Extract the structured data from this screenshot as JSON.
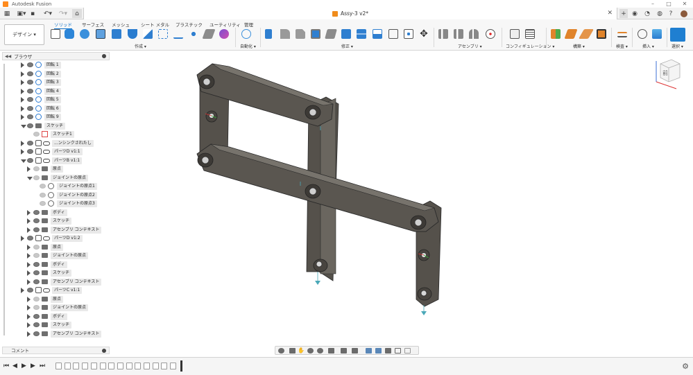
{
  "window": {
    "title": "Autodesk Fusion"
  },
  "document": {
    "name": "Assy-3 v2*"
  },
  "toolbar": {
    "workspace": "デザイン",
    "tabs": [
      "ソリッド",
      "サーフェス",
      "メッシュ",
      "シート メタル",
      "プラスチック",
      "ユーティリティ",
      "管理"
    ],
    "active_tab": "ソリッド",
    "groups": {
      "create": "作成",
      "automate": "自動化",
      "modify": "修正",
      "assemble": "アセンブリ",
      "configure": "コンフィギュレーション",
      "construct": "構築",
      "inspect": "検査",
      "insert": "挿入",
      "select": "選択"
    }
  },
  "browser": {
    "title": "ブラウザ",
    "rows": [
      {
        "label": "回転 1",
        "icon": "joint-icon",
        "indent": 0
      },
      {
        "label": "回転 2",
        "icon": "joint-icon",
        "indent": 0
      },
      {
        "label": "回転 3",
        "icon": "joint-icon",
        "indent": 0
      },
      {
        "label": "回転 4",
        "icon": "joint-icon",
        "indent": 0
      },
      {
        "label": "回転 5",
        "icon": "joint-icon",
        "indent": 0
      },
      {
        "label": "回転 6",
        "icon": "joint-icon",
        "indent": 0
      },
      {
        "label": "回転 9",
        "icon": "joint-icon",
        "indent": 0
      },
      {
        "label": "スケッチ",
        "icon": "folder-icon",
        "indent": 0
      },
      {
        "label": "スケッチ1",
        "icon": "sketch-icon",
        "indent": 1
      },
      {
        "label": "...ンシンクされたし",
        "icon": "link-icon",
        "indent": 0
      },
      {
        "label": "パーツD v1:1",
        "icon": "link-icon",
        "indent": 0
      },
      {
        "label": "パーツB v1:1",
        "icon": "link-icon",
        "indent": 0
      },
      {
        "label": "原点",
        "icon": "folder-icon",
        "indent": 1
      },
      {
        "label": "ジョイントの原点",
        "icon": "folder-icon",
        "indent": 1
      },
      {
        "label": "ジョイントの原点1",
        "icon": "origin-icon",
        "indent": 2
      },
      {
        "label": "ジョイントの原点2",
        "icon": "origin-icon",
        "indent": 2
      },
      {
        "label": "ジョイントの原点3",
        "icon": "origin-icon",
        "indent": 2
      },
      {
        "label": "ボディ",
        "icon": "folder-icon",
        "indent": 1
      },
      {
        "label": "スケッチ",
        "icon": "folder-icon",
        "indent": 1
      },
      {
        "label": "アセンブリ コンテキスト",
        "icon": "folder-icon",
        "indent": 1
      },
      {
        "label": "パーツD v1:2",
        "icon": "link-icon",
        "indent": 0
      },
      {
        "label": "原点",
        "icon": "folder-icon",
        "indent": 1
      },
      {
        "label": "ジョイントの原点",
        "icon": "folder-icon",
        "indent": 1
      },
      {
        "label": "ボディ",
        "icon": "folder-icon",
        "indent": 1
      },
      {
        "label": "スケッチ",
        "icon": "folder-icon",
        "indent": 1
      },
      {
        "label": "アセンブリ コンテキスト",
        "icon": "folder-icon",
        "indent": 1
      },
      {
        "label": "パーツC v1:1",
        "icon": "link-icon",
        "indent": 0
      },
      {
        "label": "原点",
        "icon": "folder-icon",
        "indent": 1
      },
      {
        "label": "ジョイントの原点",
        "icon": "folder-icon",
        "indent": 1
      },
      {
        "label": "ボディ",
        "icon": "folder-icon",
        "indent": 1
      },
      {
        "label": "スケッチ",
        "icon": "folder-icon",
        "indent": 1
      },
      {
        "label": "アセンブリ コンテキスト",
        "icon": "folder-icon",
        "indent": 1
      }
    ]
  },
  "comments": {
    "title": "コメント"
  },
  "viewcube": {
    "face": "前"
  },
  "colors": {
    "accent": "#0a6fc9",
    "part": "#5a5650",
    "part_top": "#77736c"
  }
}
